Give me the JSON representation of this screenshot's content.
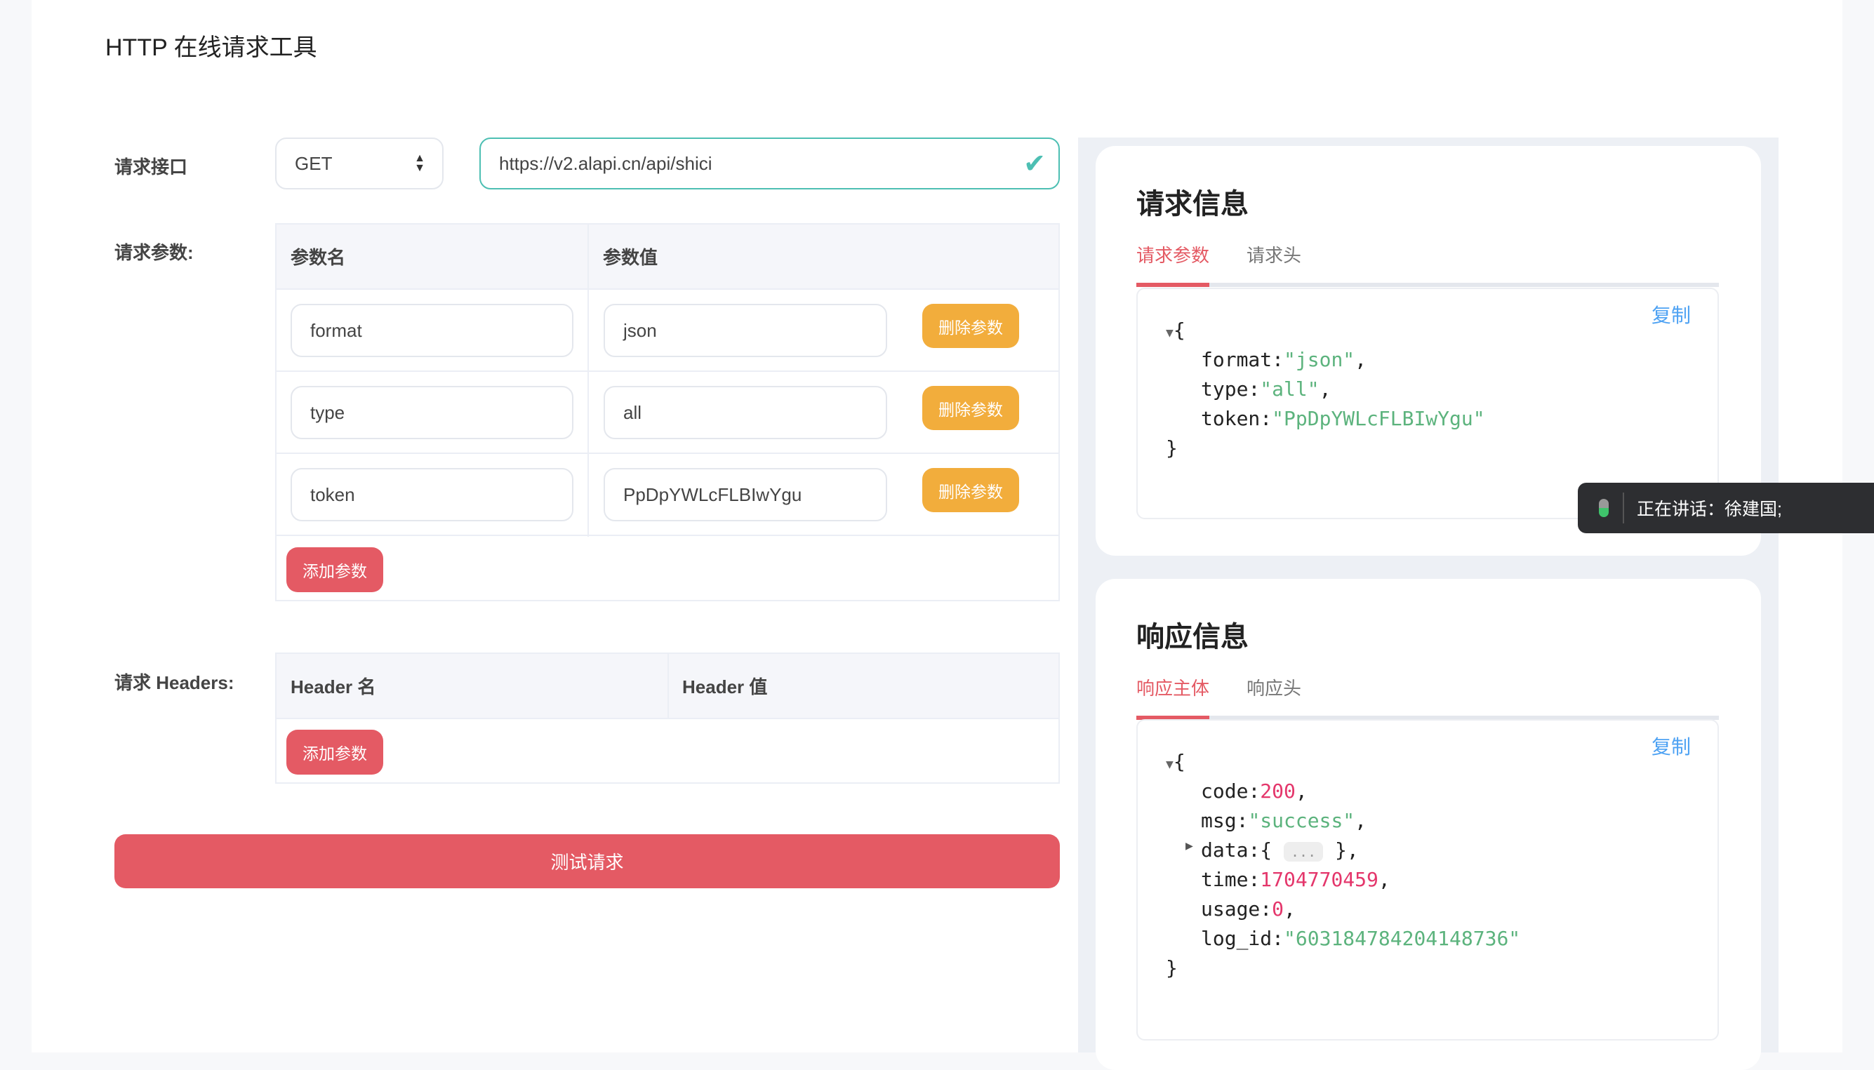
{
  "title": "HTTP 在线请求工具",
  "request": {
    "label": "请求接口",
    "method": "GET",
    "url": "https://v2.alapi.cn/api/shici"
  },
  "params": {
    "label": "请求参数:",
    "col_name": "参数名",
    "col_value": "参数值",
    "delete_label": "删除参数",
    "add_label": "添加参数",
    "rows": [
      {
        "name": "format",
        "value": "json"
      },
      {
        "name": "type",
        "value": "all"
      },
      {
        "name": "token",
        "value": "PpDpYWLcFLBIwYgu"
      }
    ]
  },
  "headers": {
    "label": "请求 Headers:",
    "col_name": "Header 名",
    "col_value": "Header 值",
    "add_label": "添加参数"
  },
  "test_button": "测试请求",
  "request_info": {
    "title": "请求信息",
    "tabs": [
      "请求参数",
      "请求头"
    ],
    "copy": "复制",
    "json": [
      {
        "k": "format",
        "v": "\"json\"",
        "t": "str"
      },
      {
        "k": "type",
        "v": "\"all\"",
        "t": "str"
      },
      {
        "k": "token",
        "v": "\"PpDpYWLcFLBIwYgu\"",
        "t": "str"
      }
    ]
  },
  "response_info": {
    "title": "响应信息",
    "tabs": [
      "响应主体",
      "响应头"
    ],
    "copy": "复制",
    "json": [
      {
        "k": "code",
        "v": "200",
        "t": "num"
      },
      {
        "k": "msg",
        "v": "\"success\"",
        "t": "str"
      },
      {
        "k": "data",
        "v": "...",
        "t": "collapsed"
      },
      {
        "k": "time",
        "v": "1704770459",
        "t": "num"
      },
      {
        "k": "usage",
        "v": "0",
        "t": "num"
      },
      {
        "k": "log_id",
        "v": "\"603184784204148736\"",
        "t": "str"
      }
    ]
  },
  "toast": {
    "text": "正在讲话：徐建国;",
    "icon": "microphone-icon"
  },
  "colors": {
    "accent": "#e45a64",
    "warning": "#f2ad3c",
    "valid": "#4dbfb3",
    "link": "#4ea2f3"
  }
}
